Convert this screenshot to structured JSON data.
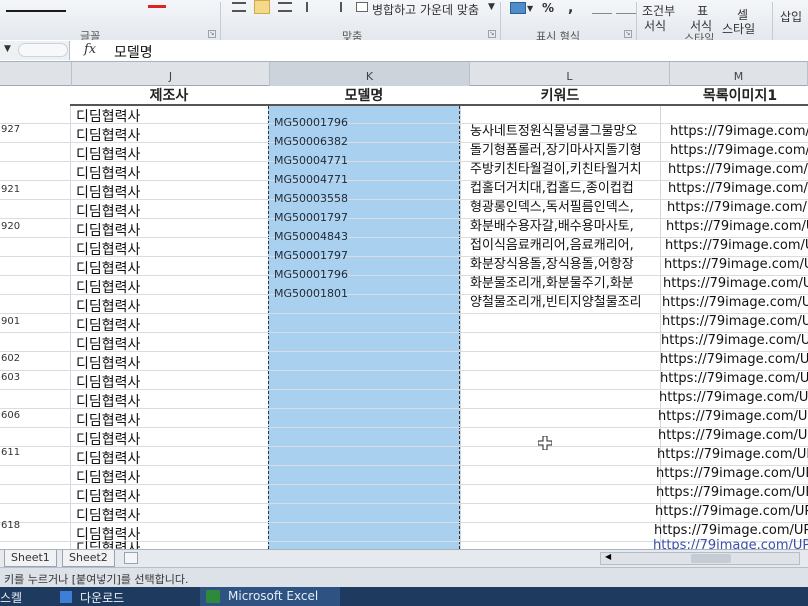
{
  "ribbon": {
    "group_font": "글꼴",
    "group_align": "맞춤",
    "group_number": "표시 형식",
    "group_style": "스타일",
    "merge_center": "병합하고 가운데 맞춤",
    "percent": "%",
    "comma": ",",
    "conditional_1": "조건부",
    "conditional_2": "서식",
    "table_1": "표",
    "table_2": "서식",
    "cell_1": "셀",
    "cell_2": "스타일",
    "insert": "삽입"
  },
  "formula_bar": {
    "fx": "fx",
    "value": "모델명"
  },
  "columns": {
    "j": "J",
    "k": "K",
    "l": "L",
    "m": "M"
  },
  "header_row": {
    "j": "제조사",
    "k": "모델명",
    "l": "키워드",
    "m": "목록이미지1"
  },
  "row_numbers": [
    "927",
    "921",
    "920",
    "901",
    "602",
    "603",
    "606",
    "611",
    "618"
  ],
  "manufacturer": [
    "디딤협력사",
    "디딤협력사",
    "디딤협력사",
    "디딤협력사",
    "디딤협력사",
    "디딤협력사",
    "디딤협력사",
    "디딤협력사",
    "디딤협력사",
    "디딤협력사",
    "디딤협력사",
    "디딤협력사",
    "디딤협력사",
    "디딤협력사",
    "디딤협력사",
    "디딤협력사",
    "디딤협력사",
    "디딤협력사",
    "디딤협력사",
    "디딤협력사",
    "디딤협력사",
    "디딤협력사",
    "디딤협력사",
    "디딤협력사"
  ],
  "models": [
    "MG50001796",
    "MG50006382",
    "MG50004771",
    "MG50004771",
    "MG50003558",
    "MG50001797",
    "MG50004843",
    "MG50001797",
    "MG50001796",
    "MG50001801"
  ],
  "keywords": [
    "농사네트정원식물넝쿨그물망오",
    "돌기형폼롤러,장기마사지돌기형",
    "주방키친타월걸이,키친타월거치",
    "컵홀더거치대,컵홀드,종이컵컵",
    "형광롱인덱스,독서필름인덱스,",
    "화분배수용자갈,배수용마사토,",
    "접이식음료캐리어,음료캐리어,",
    "화분장식용돌,장식용돌,어항장",
    "화분물조리개,화분물주기,화분",
    "양철물조리개,빈티지양철물조리"
  ],
  "urls": [
    "https://79image.com/UP",
    "https://79image.com/UP",
    "https://79image.com/UP",
    "https://79image.com/UP",
    "https://79image.com/UP",
    "https://79image.com/UP",
    "https://79image.com/UP",
    "https://79image.com/UP",
    "https://79image.com/UP",
    "https://79image.com/UPM",
    "https://79image.com/UPM",
    "https://79image.com/UPM",
    "https://79image.com/UPM",
    "https://79image.com/UPM",
    "https://79image.com/UPM",
    "https://79image.com/UPM",
    "https://79image.com/UPMD",
    "https://79image.com/UPMD",
    "https://79image.com/UPMD",
    "https://79image.com/UPMD",
    "https://79image.com/UPMD",
    "https://79image.com/UPMD",
    "https://79image.com/UPMD",
    "https://79image.com/UPMD"
  ],
  "sheets": [
    "Sheet1",
    "Sheet2"
  ],
  "status_text": "키를 누르거나 [붙여넣기]를 선택합니다.",
  "taskbar": {
    "start": "스켈",
    "download": "다운로드",
    "excel": "Microsoft Excel"
  }
}
